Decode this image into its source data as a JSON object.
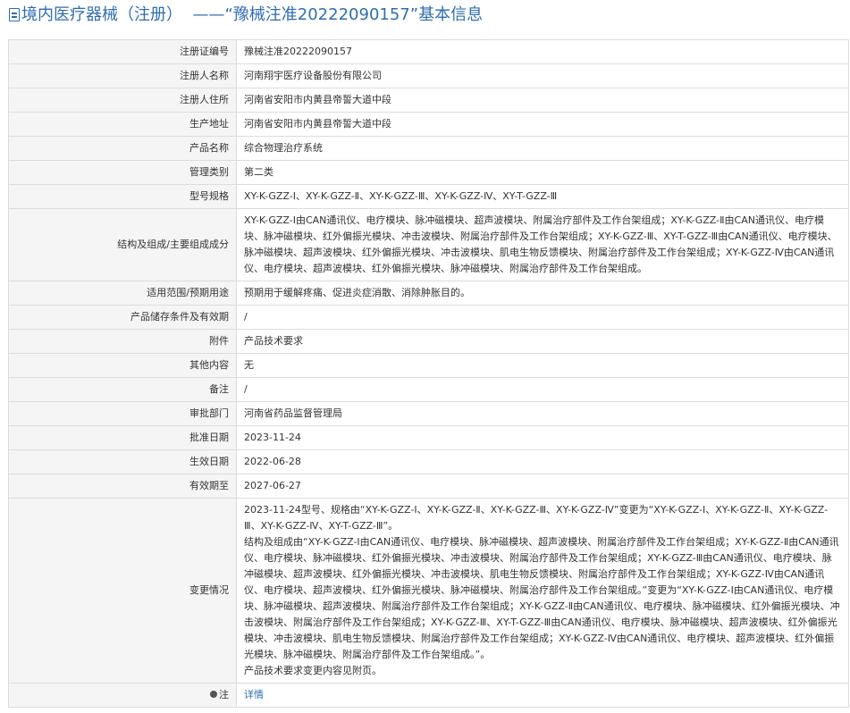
{
  "page": {
    "title_prefix": "境内医疗器械（注册）",
    "title_dash": "——",
    "title_main": "“豫械注准20222090157”基本信息"
  },
  "rows": [
    {
      "key": "reg_no",
      "label": "注册证编号",
      "value": "豫械注准20222090157"
    },
    {
      "key": "registrant",
      "label": "注册人名称",
      "value": "河南翔宇医疗设备股份有限公司"
    },
    {
      "key": "registrant_address",
      "label": "注册人住所",
      "value": "河南省安阳市内黄县帝誓大道中段"
    },
    {
      "key": "production_address",
      "label": "生产地址",
      "value": "河南省安阳市内黄县帝誓大道中段"
    },
    {
      "key": "product_name",
      "label": "产品名称",
      "value": "综合物理治疗系统"
    },
    {
      "key": "category",
      "label": "管理类别",
      "value": "第二类"
    },
    {
      "key": "model",
      "label": "型号规格",
      "value": "XY-K-GZZ-Ⅰ、XY-K-GZZ-Ⅱ、XY-K-GZZ-Ⅲ、XY-K-GZZ-Ⅳ、XY-T-GZZ-Ⅲ"
    },
    {
      "key": "structure",
      "label": "结构及组成/主要组成成分",
      "value": "XY-K-GZZ-Ⅰ由CAN通讯仪、电疗模块、脉冲磁模块、超声波模块、附属治疗部件及工作台架组成；XY-K-GZZ-Ⅱ由CAN通讯仪、电疗模块、脉冲磁模块、红外偏振光模块、冲击波模块、附属治疗部件及工作台架组成；XY-K-GZZ-Ⅲ、XY-T-GZZ-Ⅲ由CAN通讯仪、电疗模块、脉冲磁模块、超声波模块、红外偏振光模块、冲击波模块、肌电生物反馈模块、附属治疗部件及工作台架组成；XY-K-GZZ-Ⅳ由CAN通讯仪、电疗模块、超声波模块、红外偏振光模块、脉冲磁模块、附属治疗部件及工作台架组成。"
    },
    {
      "key": "scope",
      "label": "适用范围/预期用途",
      "value": "预期用于缓解疼痛、促进炎症消散、消除肿胀目的。"
    },
    {
      "key": "storage",
      "label": "产品储存条件及有效期",
      "value": "/"
    },
    {
      "key": "attachment",
      "label": "附件",
      "value": "产品技术要求"
    },
    {
      "key": "other",
      "label": "其他内容",
      "value": "无"
    },
    {
      "key": "remark",
      "label": "备注",
      "value": "/"
    },
    {
      "key": "dept",
      "label": "审批部门",
      "value": "河南省药品监督管理局"
    },
    {
      "key": "approval_date",
      "label": "批准日期",
      "value": "2023-11-24"
    },
    {
      "key": "effective_date",
      "label": "生效日期",
      "value": "2022-06-28"
    },
    {
      "key": "expiry",
      "label": "有效期至",
      "value": "2027-06-27"
    }
  ],
  "changes": {
    "label": "变更情况",
    "para1": "2023-11-24型号、规格由“XY-K-GZZ-Ⅰ、XY-K-GZZ-Ⅱ、XY-K-GZZ-Ⅲ、XY-K-GZZ-Ⅳ”变更为“XY-K-GZZ-Ⅰ、XY-K-GZZ-Ⅱ、XY-K-GZZ-Ⅲ、XY-K-GZZ-Ⅳ、XY-T-GZZ-Ⅲ”。",
    "para2": "结构及组成由“XY-K-GZZ-Ⅰ由CAN通讯仪、电疗模块、脉冲磁模块、超声波模块、附属治疗部件及工作台架组成；XY-K-GZZ-Ⅱ由CAN通讯仪、电疗模块、脉冲磁模块、红外偏振光模块、冲击波模块、附属治疗部件及工作台架组成；XY-K-GZZ-Ⅲ由CAN通讯仪、电疗模块、脉冲磁模块、超声波模块、红外偏振光模块、冲击波模块、肌电生物反馈模块、附属治疗部件及工作台架组成；XY-K-GZZ-Ⅳ由CAN通讯仪、电疗模块、超声波模块、红外偏振光模块、脉冲磁模块、附属治疗部件及工作台架组成。”变更为“XY-K-GZZ-Ⅰ由CAN通讯仪、电疗模块、脉冲磁模块、超声波模块、附属治疗部件及工作台架组成；XY-K-GZZ-Ⅱ由CAN通讯仪、电疗模块、脉冲磁模块、红外偏振光模块、冲击波模块、附属治疗部件及工作台架组成；XY-K-GZZ-Ⅲ、XY-T-GZZ-Ⅲ由CAN通讯仪、电疗模块、脉冲磁模块、超声波模块、红外偏振光模块、冲击波模块、肌电生物反馈模块、附属治疗部件及工作台架组成；XY-K-GZZ-Ⅳ由CAN通讯仪、电疗模块、超声波模块、红外偏振光模块、脉冲磁模块、附属治疗部件及工作台架组成。”。",
    "para3": "产品技术要求变更内容见附页。"
  },
  "note": {
    "label": "注",
    "icon": "dot-icon",
    "link_text": "详情"
  }
}
